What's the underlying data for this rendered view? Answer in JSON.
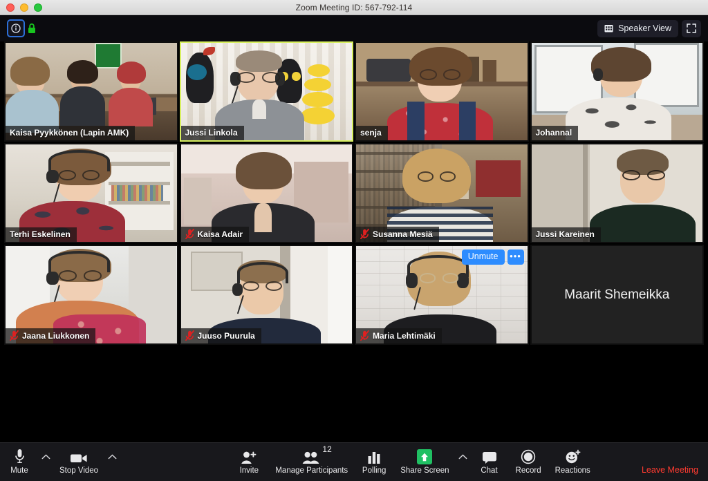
{
  "window": {
    "title": "Zoom Meeting ID: 567-792-114",
    "traffic_lights": [
      "close",
      "minimize",
      "maximize"
    ]
  },
  "topbar": {
    "info_icon": "info-icon",
    "lock_icon": "encryption-lock-icon",
    "view_button": {
      "label": "Speaker View",
      "icon": "grid-view-icon"
    },
    "fullscreen_icon": "enter-fullscreen-icon"
  },
  "grid": {
    "columns": 4,
    "active_speaker_border_color": "#d8f060",
    "participants": [
      {
        "name": "Kaisa Pyykkönen (Lapin AMK)",
        "muted": false,
        "video": true,
        "active": false,
        "scene": "class"
      },
      {
        "name": "Jussi Linkola",
        "muted": false,
        "video": true,
        "active": true,
        "scene": "jussi"
      },
      {
        "name": "senja",
        "muted": false,
        "video": true,
        "active": false,
        "scene": "senja"
      },
      {
        "name": "Johannal",
        "muted": false,
        "video": true,
        "active": false,
        "scene": "johanna"
      },
      {
        "name": "Terhi Eskelinen",
        "muted": false,
        "video": true,
        "active": false,
        "scene": "terhi"
      },
      {
        "name": "Kaisa Adair",
        "muted": true,
        "video": true,
        "active": false,
        "scene": "adair"
      },
      {
        "name": "Susanna Mesiä",
        "muted": true,
        "video": true,
        "active": false,
        "scene": "susanna"
      },
      {
        "name": "Jussi Kareinen",
        "muted": false,
        "video": true,
        "active": false,
        "scene": "kareinen"
      },
      {
        "name": "Jaana Liukkonen",
        "muted": true,
        "video": true,
        "active": false,
        "scene": "jaana"
      },
      {
        "name": "Juuso Puurula",
        "muted": true,
        "video": true,
        "active": false,
        "scene": "juuso"
      },
      {
        "name": "Maria Lehtimäki",
        "muted": true,
        "video": true,
        "active": false,
        "scene": "maria",
        "hover_controls": {
          "unmute_label": "Unmute",
          "more_label": "•••"
        }
      },
      {
        "name": "Maarit Shemeikka",
        "muted": false,
        "video": false,
        "active": false,
        "scene": "none"
      }
    ]
  },
  "toolbar": {
    "mute": {
      "label": "Mute",
      "icon": "microphone-icon"
    },
    "audio_options_caret": "chevron-up-icon",
    "stop_video": {
      "label": "Stop Video",
      "icon": "video-camera-icon"
    },
    "video_options_caret": "chevron-up-icon",
    "invite": {
      "label": "Invite",
      "icon": "person-plus-icon"
    },
    "manage_participants": {
      "label": "Manage Participants",
      "icon": "people-icon",
      "count": "12"
    },
    "polling": {
      "label": "Polling",
      "icon": "bar-chart-icon"
    },
    "share_screen": {
      "label": "Share Screen",
      "icon": "share-arrow-up-icon",
      "accent": "#20c063"
    },
    "share_options_caret": "chevron-up-icon",
    "chat": {
      "label": "Chat",
      "icon": "speech-bubble-icon"
    },
    "record": {
      "label": "Record",
      "icon": "record-circle-icon"
    },
    "reactions": {
      "label": "Reactions",
      "icon": "smiley-plus-icon"
    },
    "leave_meeting": {
      "label": "Leave Meeting",
      "color": "#ff3b30"
    }
  }
}
